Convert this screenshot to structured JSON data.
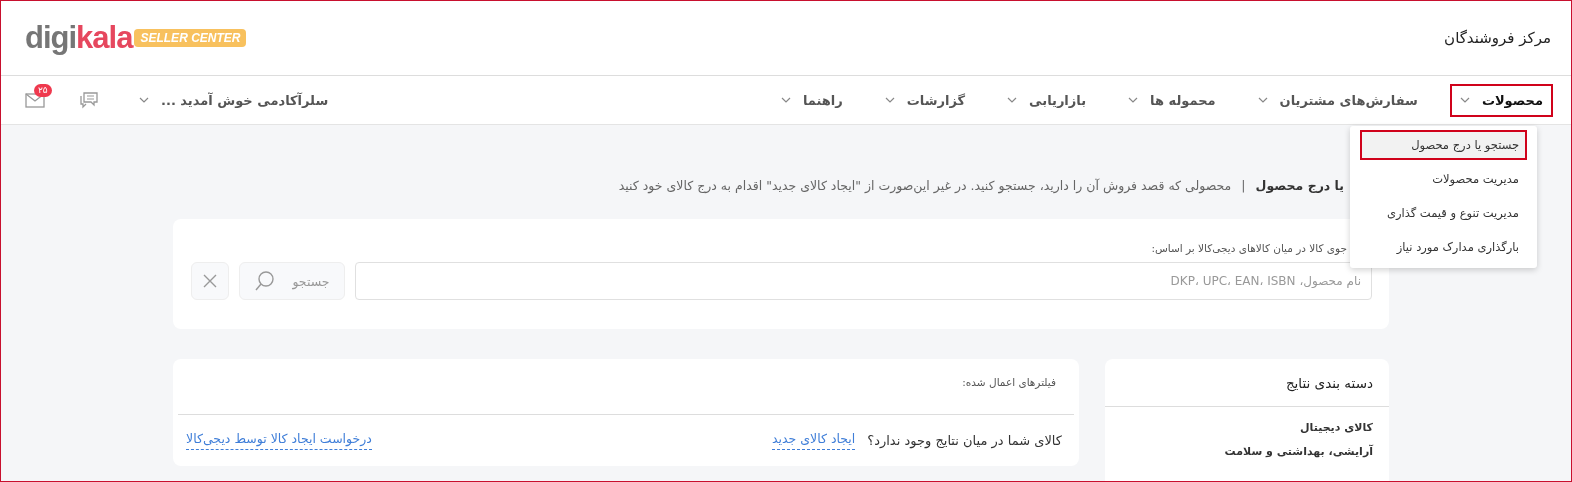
{
  "header": {
    "title": "مرکز فروشندگان",
    "logo": {
      "part1": "digi",
      "part2": "kala",
      "badge": "SELLER CENTER"
    }
  },
  "nav": {
    "items": [
      {
        "label": "محصولات",
        "selected": true,
        "highlighted": true
      },
      {
        "label": "سفارش‌های مشتریان",
        "selected": false,
        "highlighted": false
      },
      {
        "label": "محموله ها",
        "selected": false,
        "highlighted": false
      },
      {
        "label": "بازاریابی",
        "selected": false,
        "highlighted": false
      },
      {
        "label": "گزارشات",
        "selected": false,
        "highlighted": false
      },
      {
        "label": "راهنما",
        "selected": false,
        "highlighted": false
      }
    ],
    "user": "سلرآکادمی خوش آمدید ...",
    "mail_badge": "۲۵"
  },
  "dropdown": [
    {
      "label": "جستجو یا درج محصول",
      "selected": true,
      "highlighted": true
    },
    {
      "label": "مدیریت محصولات",
      "selected": false,
      "highlighted": false
    },
    {
      "label": "مدیریت تنوع و قیمت گذاری",
      "selected": false,
      "highlighted": false
    },
    {
      "label": "بارگذاری مدارک مورد نیاز",
      "selected": false,
      "highlighted": false
    }
  ],
  "intro": {
    "title": "یا درج محصول",
    "separator": "|",
    "description": "محصولی که قصد فروش آن را دارید، جستجو کنید. در غیر این‌صورت از \"ایجاد کالای جدید\" اقدام به درج کالای خود کنید"
  },
  "search": {
    "label": "جوی کالا در میان کالاهای دیجی‌کالا بر اساس:",
    "placeholder": "نام محصول، DKP، UPC، EAN، ISBN",
    "button": "جستجو"
  },
  "categories": {
    "title": "دسته بندی نتایج",
    "items": [
      "کالای دیجیتال",
      "آرایشی، بهداشتی و سلامت"
    ]
  },
  "filters": {
    "title": "فیلترهای اعمال شده:",
    "question": "کالای شما در میان نتایج وجود ندارد؟",
    "create_link": "ایجاد کالای جدید",
    "request_link": "درخواست ایجاد کالا توسط دیجی‌کالا"
  }
}
